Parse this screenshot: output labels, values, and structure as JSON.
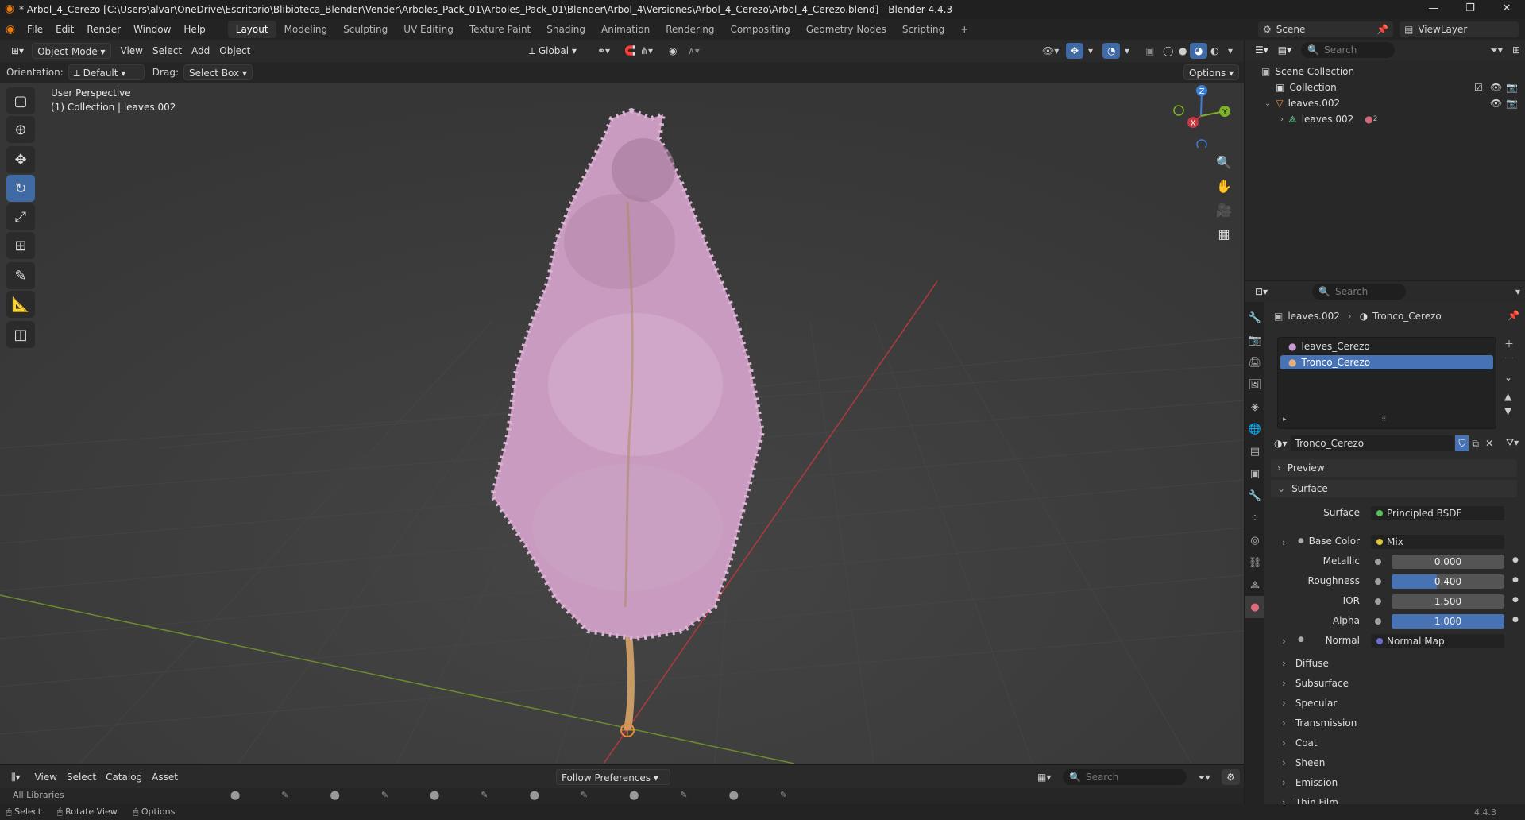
{
  "title_bar": {
    "title": "* Arbol_4_Cerezo [C:\\Users\\alvar\\OneDrive\\Escritorio\\Blibioteca_Blender\\Vender\\Arboles_Pack_01\\Arboles_Pack_01\\Blender\\Arbol_4\\Versiones\\Arbol_4_Cerezo\\Arbol_4_Cerezo.blend] - Blender 4.4.3",
    "minimize": "—",
    "maximize": "❐",
    "close": "✕"
  },
  "top_menu": {
    "items": [
      "File",
      "Edit",
      "Render",
      "Window",
      "Help"
    ],
    "workspaces": [
      "Layout",
      "Modeling",
      "Sculpting",
      "UV Editing",
      "Texture Paint",
      "Shading",
      "Animation",
      "Rendering",
      "Compositing",
      "Geometry Nodes",
      "Scripting"
    ],
    "add_tab": "+",
    "scene": "Scene",
    "view_layer": "ViewLayer"
  },
  "viewport_header": {
    "mode": "Object Mode",
    "menus": [
      "View",
      "Select",
      "Add",
      "Object"
    ],
    "transform_orientation": "Global",
    "options_label": "Options"
  },
  "tool_settings": {
    "orientation_label": "Orientation:",
    "orientation_value": "Default",
    "drag_label": "Drag:",
    "drag_value": "Select Box"
  },
  "viewport": {
    "perspective": "User Perspective",
    "collection_info": "(1) Collection | leaves.002",
    "gizmo": {
      "x": "X",
      "y": "Y",
      "z": "Z"
    }
  },
  "tools": [
    {
      "name": "select-box-tool",
      "icon": "▢",
      "active": false
    },
    {
      "name": "cursor-tool",
      "icon": "⊕",
      "active": false
    },
    {
      "name": "move-tool",
      "icon": "✥",
      "active": false
    },
    {
      "name": "rotate-tool",
      "icon": "↻",
      "active": true
    },
    {
      "name": "scale-tool",
      "icon": "⤢",
      "active": false
    },
    {
      "name": "transform-tool",
      "icon": "⊞",
      "active": false
    },
    {
      "name": "annotate-tool",
      "icon": "✎",
      "active": false
    },
    {
      "name": "measure-tool",
      "icon": "📐",
      "active": false
    },
    {
      "name": "add-cube-tool",
      "icon": "◫",
      "active": false
    }
  ],
  "asset_browser": {
    "menus": [
      "View",
      "Select",
      "Catalog",
      "Asset"
    ],
    "import_method": "Follow Preferences",
    "search_placeholder": "Search",
    "library": "All Libraries"
  },
  "status_bar": {
    "items": [
      "Select",
      "Rotate View",
      "Options"
    ],
    "version": "4.4.3"
  },
  "outliner": {
    "search_placeholder": "Search",
    "scene_collection": "Scene Collection",
    "collection": "Collection",
    "object": "leaves.002",
    "mesh": "leaves.002",
    "material_count": "2"
  },
  "properties": {
    "search_placeholder": "Search",
    "breadcrumb_object": "leaves.002",
    "breadcrumb_material": "Tronco_Cerezo",
    "slots": [
      "leaves_Cerezo",
      "Tronco_Cerezo"
    ],
    "selected_slot": 1,
    "material_name": "Tronco_Cerezo",
    "preview_label": "Preview",
    "surface_label": "Surface",
    "surface_field_label": "Surface",
    "surface_value": "Principled BSDF",
    "base_color_label": "Base Color",
    "base_color_value": "Mix",
    "metallic_label": "Metallic",
    "metallic_value": "0.000",
    "metallic_fraction": 0.0,
    "roughness_label": "Roughness",
    "roughness_value": "0.400",
    "roughness_fraction": 0.4,
    "ior_label": "IOR",
    "ior_value": "1.500",
    "alpha_label": "Alpha",
    "alpha_value": "1.000",
    "alpha_fraction": 1.0,
    "normal_label": "Normal",
    "normal_value": "Normal Map",
    "subpanels": [
      "Diffuse",
      "Subsurface",
      "Specular",
      "Transmission",
      "Coat",
      "Sheen",
      "Emission",
      "Thin Film"
    ]
  },
  "colors": {
    "accent": "#4772b3",
    "x_axis": "#c9383f",
    "y_axis": "#7fb226",
    "z_axis": "#3d7fd6",
    "blossom": "#d4a9cc",
    "trunk": "#c79a66"
  }
}
